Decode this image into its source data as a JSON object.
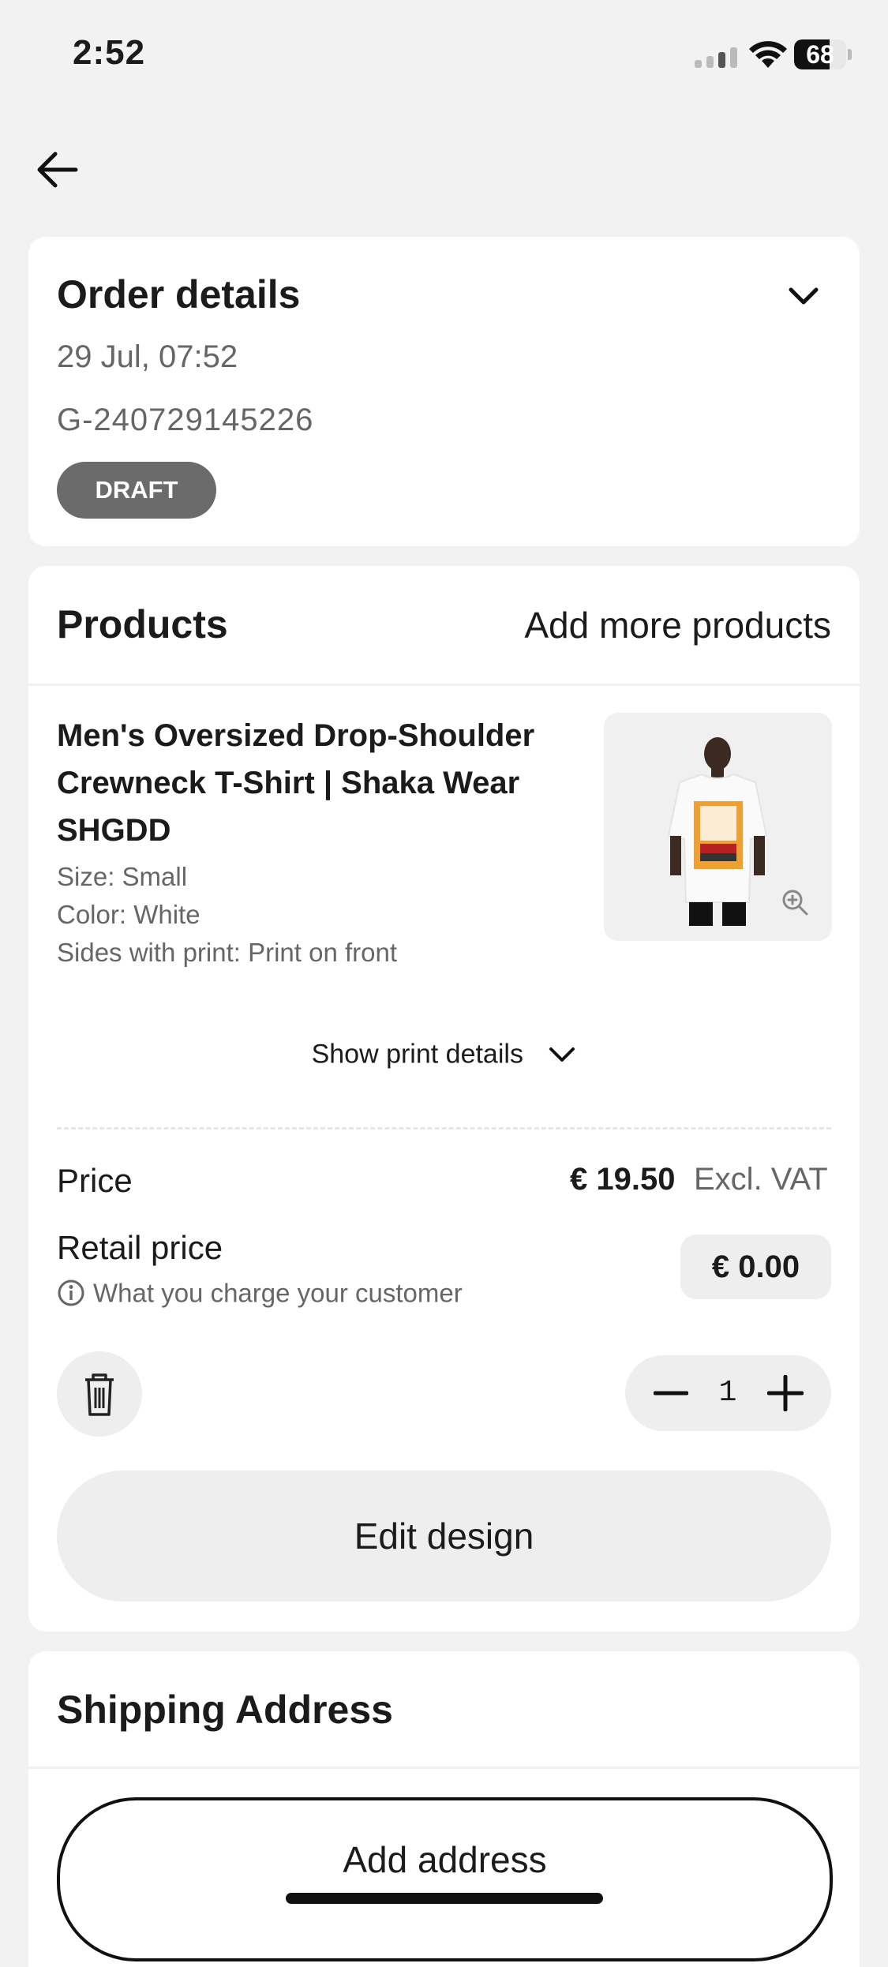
{
  "status_bar": {
    "time": "2:52",
    "battery": "68",
    "battery_level": 0.68
  },
  "order": {
    "title": "Order details",
    "date": "29 Jul, 07:52",
    "id": "G-240729145226",
    "status": "DRAFT"
  },
  "products": {
    "title": "Products",
    "add_more": "Add more products",
    "item": {
      "name": "Men's Oversized Drop-Shoulder Crewneck T-Shirt | Shaka Wear SHGDD",
      "size": "Size:  Small",
      "color": "Color:  White",
      "sides": "Sides with print:  Print on front",
      "show_print_details": "Show print details",
      "price_label": "Price",
      "price_value": "€ 19.50",
      "price_vat": "Excl. VAT",
      "retail_label": "Retail price",
      "retail_note": "What you charge your customer",
      "retail_value": "€ 0.00",
      "quantity": "1",
      "edit_design": "Edit design"
    }
  },
  "shipping": {
    "title": "Shipping Address",
    "add_address": "Add address"
  },
  "colors": {
    "background": "#f2f2f2",
    "card": "#ffffff",
    "badge": "#6b6b6b",
    "muted_text": "#666666"
  }
}
